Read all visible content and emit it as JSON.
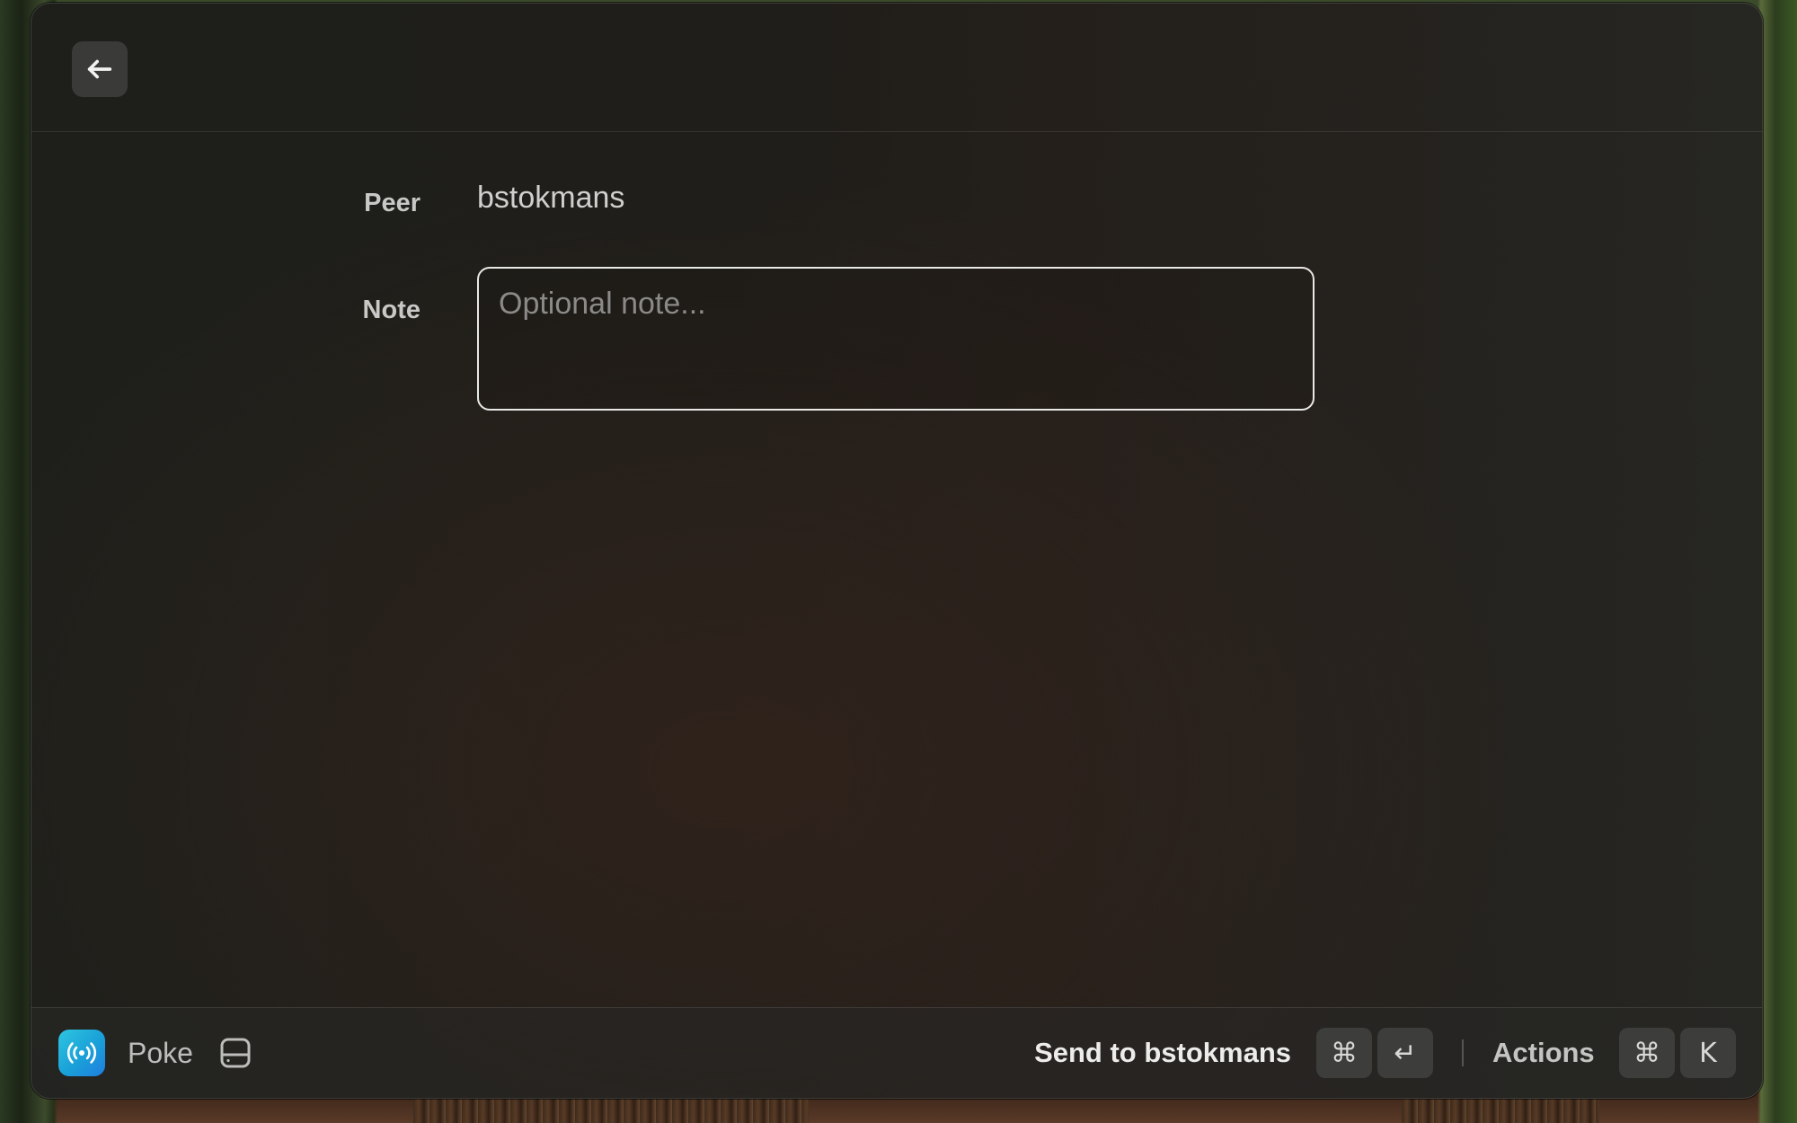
{
  "header": {
    "back_icon": "arrow-left-icon"
  },
  "form": {
    "peer_label": "Peer",
    "peer_value": "bstokmans",
    "note_label": "Note",
    "note_value": "",
    "note_placeholder": "Optional note..."
  },
  "footer": {
    "app_icon": "broadcast-icon",
    "app_name": "Poke",
    "drive_icon": "hard-drive-icon",
    "primary_action_label": "Send to bstokmans",
    "primary_shortcut_modifier": "⌘",
    "primary_shortcut_key": "↵",
    "actions_label": "Actions",
    "actions_shortcut_modifier": "⌘",
    "actions_shortcut_key": "K"
  },
  "colors": {
    "app_icon_gradient_start": "#2ec6e0",
    "app_icon_gradient_end": "#1f7ee0",
    "window_background": "#1f1e1a"
  }
}
